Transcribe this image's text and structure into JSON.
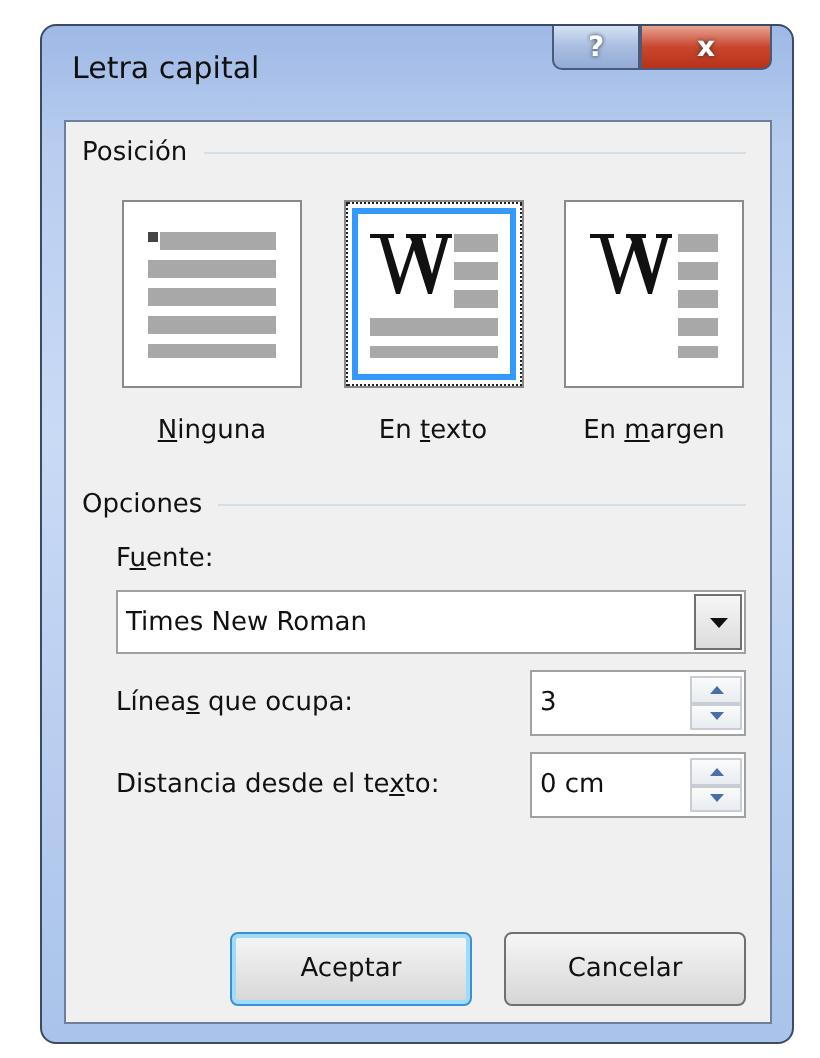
{
  "window": {
    "title": "Letra capital",
    "help": "?",
    "close": "x"
  },
  "position": {
    "legend": "Posición",
    "options": [
      {
        "kind": "none",
        "label_parts": {
          "key": "N",
          "after": "inguna"
        },
        "selected": false
      },
      {
        "kind": "in_text",
        "label_parts": {
          "before": "En ",
          "key": "t",
          "after": "exto"
        },
        "selected": true
      },
      {
        "kind": "in_margin",
        "label_parts": {
          "before": "En ",
          "key": "m",
          "after": "argen"
        },
        "selected": false
      }
    ]
  },
  "options": {
    "legend": "Opciones",
    "font": {
      "label_parts": {
        "before": "F",
        "key": "u",
        "after": "ente:"
      },
      "value": "Times New Roman"
    },
    "spinners": [
      {
        "label_parts": {
          "before": "Línea",
          "key": "s",
          "after": " que ocupa:"
        },
        "value": "3"
      },
      {
        "label_parts": {
          "before": "Distancia desde el te",
          "key": "x",
          "after": "to:"
        },
        "value": "0 cm"
      }
    ]
  },
  "buttons": [
    {
      "label": "Aceptar",
      "default": true
    },
    {
      "label": "Cancelar",
      "default": false
    }
  ]
}
